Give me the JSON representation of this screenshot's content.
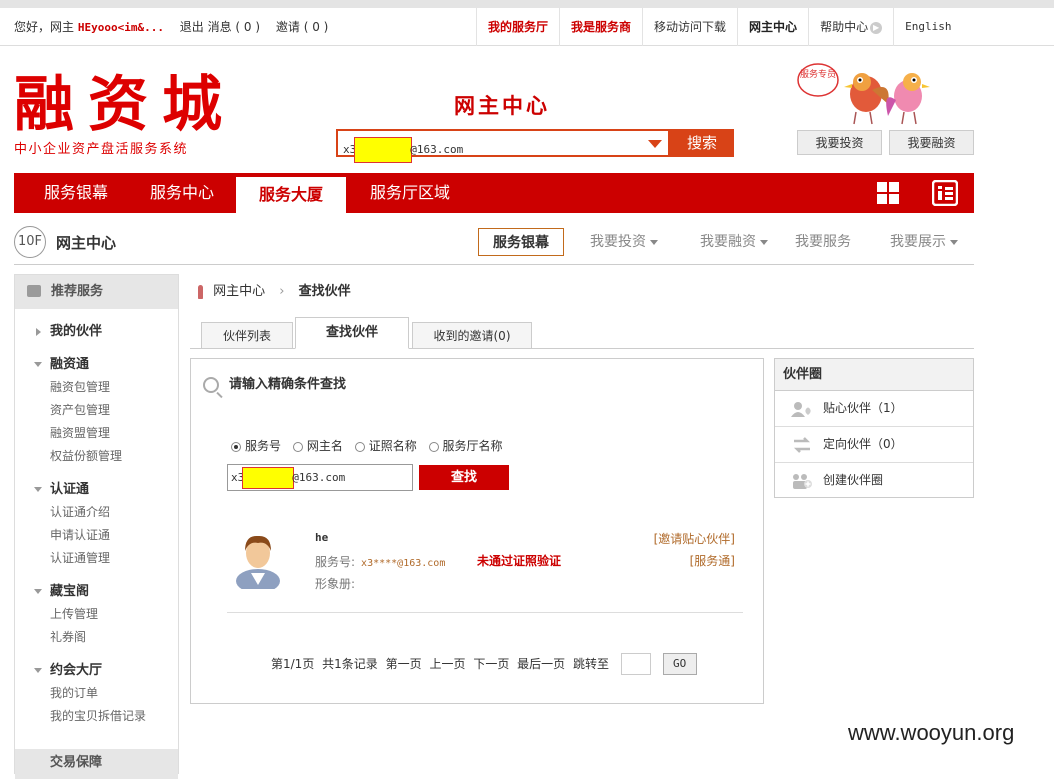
{
  "topbar": {
    "greeting": "您好，网主",
    "username": "HEyooo<im&...",
    "logout": "退出",
    "messages": "消息 ( 0 )",
    "invites": "邀请 ( 0 )",
    "nav": [
      "我的服务厅",
      "我是服务商",
      "移动访问下载",
      "网主中心",
      "帮助中心",
      "English"
    ]
  },
  "header": {
    "logo_text": "融资城",
    "logo_sub": "中小企业资产盘活服务系统",
    "title": "网主中心",
    "search_prefix": "x3",
    "search_suffix": "@163.com",
    "search_button": "搜索",
    "badge": "服务专员",
    "invest_button": "我要投资",
    "finance_button": "我要融资"
  },
  "mainnav": [
    "服务银幕",
    "服务中心",
    "服务大厦",
    "服务厅区域"
  ],
  "floor": {
    "number": "10F",
    "title": "网主中心",
    "tabs": [
      "服务银幕",
      "我要投资",
      "我要融资",
      "我要服务",
      "我要展示"
    ]
  },
  "sidebar": {
    "header": "推荐服务",
    "groups": [
      {
        "title": "我的伙伴",
        "items": []
      },
      {
        "title": "融资通",
        "items": [
          "融资包管理",
          "资产包管理",
          "融资盟管理",
          "权益份额管理"
        ]
      },
      {
        "title": "认证通",
        "items": [
          "认证通介绍",
          "申请认证通",
          "认证通管理"
        ]
      },
      {
        "title": "藏宝阁",
        "items": [
          "上传管理",
          "礼券阁"
        ]
      },
      {
        "title": "约会大厅",
        "items": [
          "我的订单",
          "我的宝贝拆借记录"
        ]
      }
    ],
    "cut_off": "交易保障"
  },
  "breadcrumb": {
    "root": "网主中心",
    "current": "查找伙伴"
  },
  "tabs": [
    "伙伴列表",
    "查找伙伴",
    "收到的邀请(0)"
  ],
  "search_panel": {
    "title": "请输入精确条件查找",
    "radios": [
      "服务号",
      "网主名",
      "证照名称",
      "服务厅名称"
    ],
    "input_prefix": "x3",
    "input_suffix": "@163.com",
    "button": "查找"
  },
  "result": {
    "name": "he",
    "service_label": "服务号:",
    "service_value": "x3****@163.com",
    "status": "未通过证照验证",
    "image_label": "形象册:",
    "invite_link": "[邀请贴心伙伴]",
    "service_link": "[服务通]"
  },
  "pager": {
    "page": "第1/1页",
    "total": "共1条记录",
    "first": "第一页",
    "prev": "上一页",
    "next": "下一页",
    "last": "最后一页",
    "jump": "跳转至",
    "go": "GO"
  },
  "circle": {
    "title": "伙伴圈",
    "items": [
      "贴心伙伴（1）",
      "定向伙伴（0）",
      "创建伙伴圈"
    ]
  },
  "watermark": "www.wooyun.org",
  "colors": {
    "brand_red": "#cc0000",
    "accent_orange": "#d84317",
    "link_brown": "#b06a2a"
  }
}
